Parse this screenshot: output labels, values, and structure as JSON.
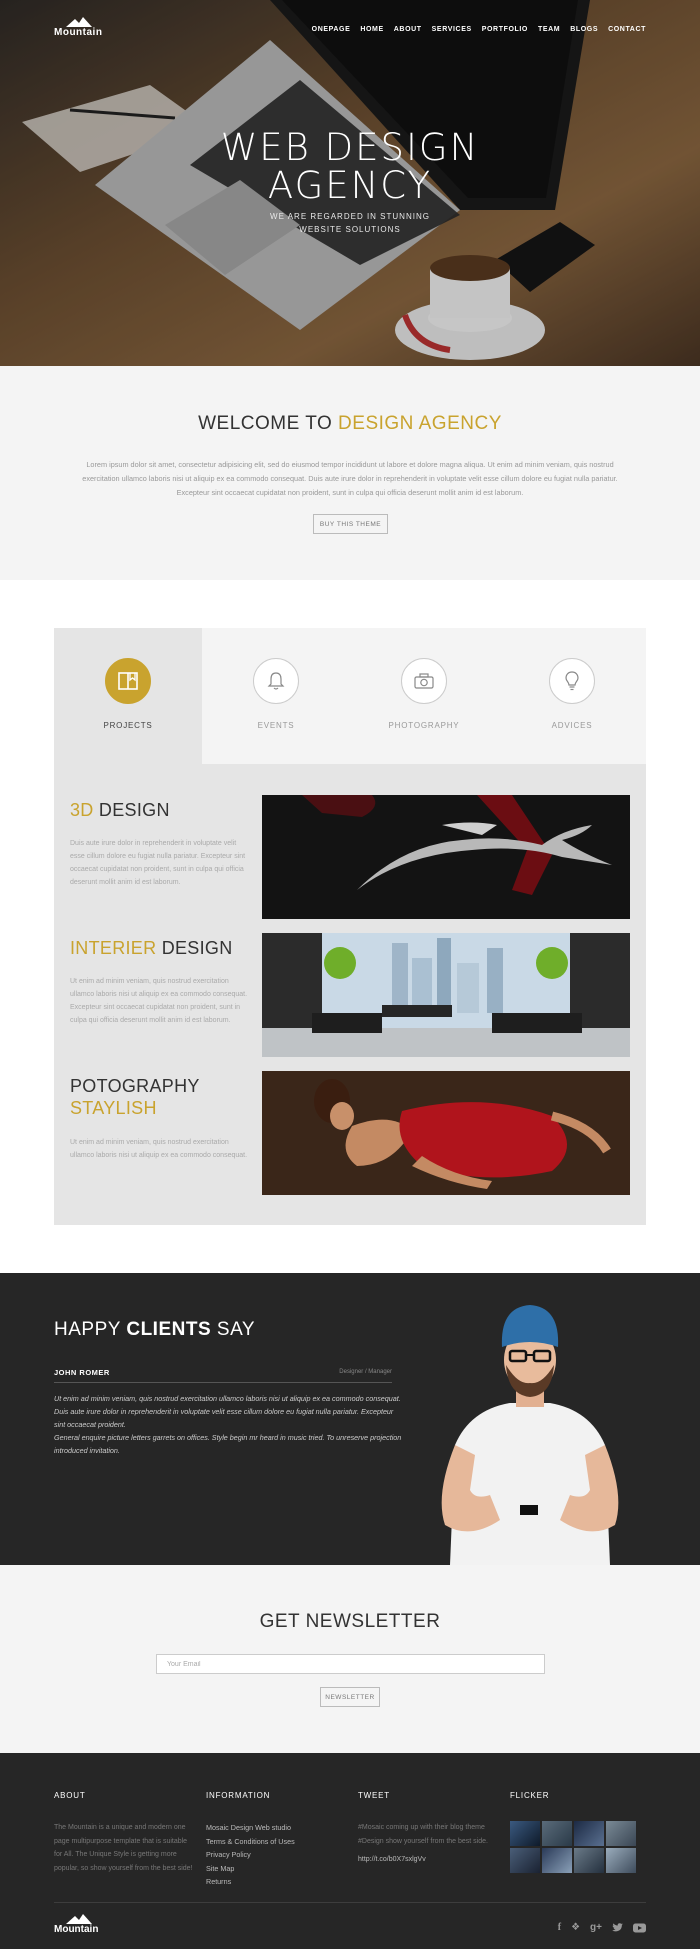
{
  "brand": {
    "logo_text": "Mountain"
  },
  "nav": {
    "items": [
      "ONEPAGE",
      "HOME",
      "ABOUT",
      "SERVICES",
      "PORTFOLIO",
      "TEAM",
      "BLOGS",
      "CONTACT"
    ]
  },
  "hero": {
    "title_line1": "WEB DESIGN",
    "title_line2": "AGENCY",
    "sub_line1": "WE ARE REGARDED IN STUNNING",
    "sub_line2": "WEBSITE SOLUTIONS"
  },
  "welcome": {
    "title_prefix": "WELCOME TO ",
    "title_accent": "DESIGN AGENCY",
    "body": "Lorem ipsum dolor sit amet, consectetur adipisicing elit, sed do eiusmod tempor incididunt ut labore et dolore magna aliqua. Ut enim ad minim veniam, quis nostrud exercitation ullamco laboris nisi ut aliquip ex ea commodo consequat. Duis aute irure dolor in reprehenderit in voluptate velit esse cillum dolore eu fugiat nulla pariatur. Excepteur sint occaecat cupidatat non proident, sunt in culpa qui officia deserunt mollit anim id est laborum.",
    "button_label": "BUY THIS THEME"
  },
  "tabs": [
    {
      "label": "PROJECTS",
      "icon": "book-icon",
      "active": true
    },
    {
      "label": "EVENTS",
      "icon": "bell-icon",
      "active": false
    },
    {
      "label": "PHOTOGRAPHY",
      "icon": "camera-icon",
      "active": false
    },
    {
      "label": "ADVICES",
      "icon": "lightbulb-icon",
      "active": false
    }
  ],
  "features": [
    {
      "title_accent": "3D",
      "title_rest": " DESIGN",
      "body": "Duis aute irure dolor in reprehenderit in voluptate velit esse cillum dolore eu fugiat nulla pariatur. Excepteur sint occaecat cupidatat non proident, sunt in culpa qui officia deserunt mollit anim id est laborum."
    },
    {
      "title_accent": "INTERIER",
      "title_rest": " DESIGN",
      "body": "Ut enim ad minim veniam, quis nostrud exercitation ullamco laboris nisi ut aliquip ex ea commodo consequat. Excepteur sint occaecat cupidatat non proident, sunt in culpa qui officia deserunt mollit anim id est laborum."
    },
    {
      "title_line1": "POTOGRAPHY",
      "title_line2": "STAYLISH",
      "body": "Ut enim ad minim veniam, quis nostrud exercitation ullamco laboris nisi ut aliquip ex ea commodo consequat."
    }
  ],
  "clients": {
    "title_prefix": "HAPPY ",
    "title_bold": "CLIENTS",
    "title_suffix": " SAY",
    "name": "JOHN ROMER",
    "role": "Designer / Manager",
    "quote_p1": "Ut enim ad minim veniam, quis nostrud exercitation ullamco laboris nisi ut aliquip ex ea commodo consequat. Duis aute irure dolor in reprehenderit in voluptate velit esse cillum dolore eu fugiat nulla pariatur. Excepteur sint occaecat proident.",
    "quote_p2": "General enquire picture letters garrets on offices. Style begin mr heard in music tried. To unreserve projection introduced invitation."
  },
  "newsletter": {
    "title": "GET NEWSLETTER",
    "placeholder": "Your Email",
    "button_label": "NEWSLETTER"
  },
  "footer": {
    "about": {
      "heading": "ABOUT",
      "text": "The Mountain is a unique and modern one page multipurpose template that is suitable for All. The Unique Style is getting more popular, so show yourself from the best side!"
    },
    "information": {
      "heading": "INFORMATION",
      "links": [
        "Mosaic Design Web studio",
        "Terms & Conditions of Uses",
        "Privacy Policy",
        "Site Map",
        "Returns"
      ]
    },
    "tweet": {
      "heading": "TWEET",
      "text": "#Mosaic coming up with their blog theme #Design show yourself from the best side.",
      "link": "http://t.co/b0X7sxlgVv"
    },
    "flicker": {
      "heading": "FLICKER"
    },
    "logo_text": "Mountain",
    "social": [
      "facebook-icon",
      "dropbox-icon",
      "google-plus-icon",
      "twitter-icon",
      "youtube-icon"
    ]
  },
  "colors": {
    "accent": "#c9a32e",
    "dark": "#262626",
    "light": "#f4f4f4"
  }
}
